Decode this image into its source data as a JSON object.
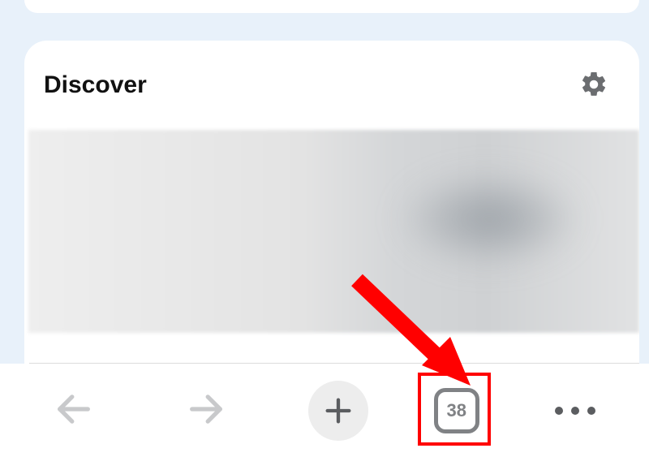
{
  "discover": {
    "title": "Discover"
  },
  "toolbar": {
    "tab_count": "38"
  }
}
